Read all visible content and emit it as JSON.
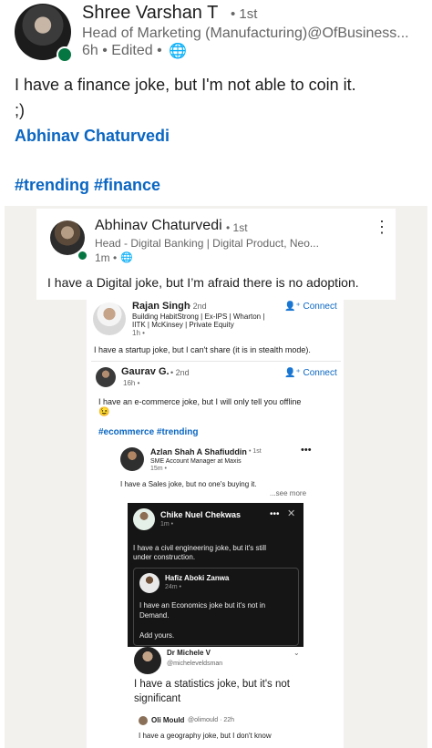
{
  "post": {
    "author_name": "Shree Varshan T",
    "author_degree": "• 1st",
    "author_headline": "Head of Marketing (Manufacturing)@OfBusiness...",
    "meta": "6h • Edited •",
    "text_line1": "I have a finance joke, but I'm not able to coin it.",
    "text_line2": ";)",
    "mention": "Abhinav Chaturvedi",
    "hashtags": "#trending #finance"
  },
  "share1": {
    "author_name": "Abhinav Chaturvedi",
    "author_degree": "• 1st",
    "author_headline": "Head - Digital Banking | Digital Product, Neo...",
    "meta": "1m •",
    "text": "I have a Digital joke, but I’m afraid there is no adoption.",
    "menu_icon": "more-vertical-icon"
  },
  "share2": {
    "author_name": "Rajan Singh",
    "author_degree": "• 2nd",
    "connect_label": "Connect",
    "headline_line1": "Building HabitStrong | Ex-IPS | Wharton |",
    "headline_line2": "IITK | McKinsey | Private Equity",
    "meta": "1h •",
    "text": "I have a startup joke, but I can't share (it is in stealth mode)."
  },
  "share3": {
    "author_name": "Gaurav G.",
    "author_degree": "• 2nd",
    "connect_label": "Connect",
    "meta": "16h •",
    "text_line1": "I have an e-commerce joke, but I will only tell you offline",
    "emoji": "😉",
    "hashtags": "#ecommerce #trending"
  },
  "share4": {
    "author_name": "Azlan Shah A Shafiuddin",
    "author_degree": "• 1st",
    "headline": "SME Account Manager at Maxis",
    "meta": "15m •",
    "text": "I have a Sales joke, but no one's buying it.",
    "see_more": "...see more"
  },
  "share5": {
    "author_name": "Chike Nuel Chekwas",
    "meta": "1m •",
    "text_line1": "I have a civil engineering joke, but it's still",
    "text_line2": "under construction.",
    "inner_author": "Hafiz Aboki Zanwa",
    "inner_meta": "24m •",
    "inner_text_line1": "I have an Economics joke but it's not in",
    "inner_text_line2": "Demand.",
    "add_yours": "Add yours."
  },
  "share6": {
    "author_name": "Dr Michele V",
    "handle": "@micheleveldsman",
    "text_line1": "I have a statistics joke, but it's not",
    "text_line2": "significant",
    "reply_author": "Oli Mould",
    "reply_handle": "@olimould · 22h",
    "reply_text": "I have a geography joke, but I don't know"
  },
  "colors": {
    "link": "#0a66c2",
    "online": "#057642"
  }
}
